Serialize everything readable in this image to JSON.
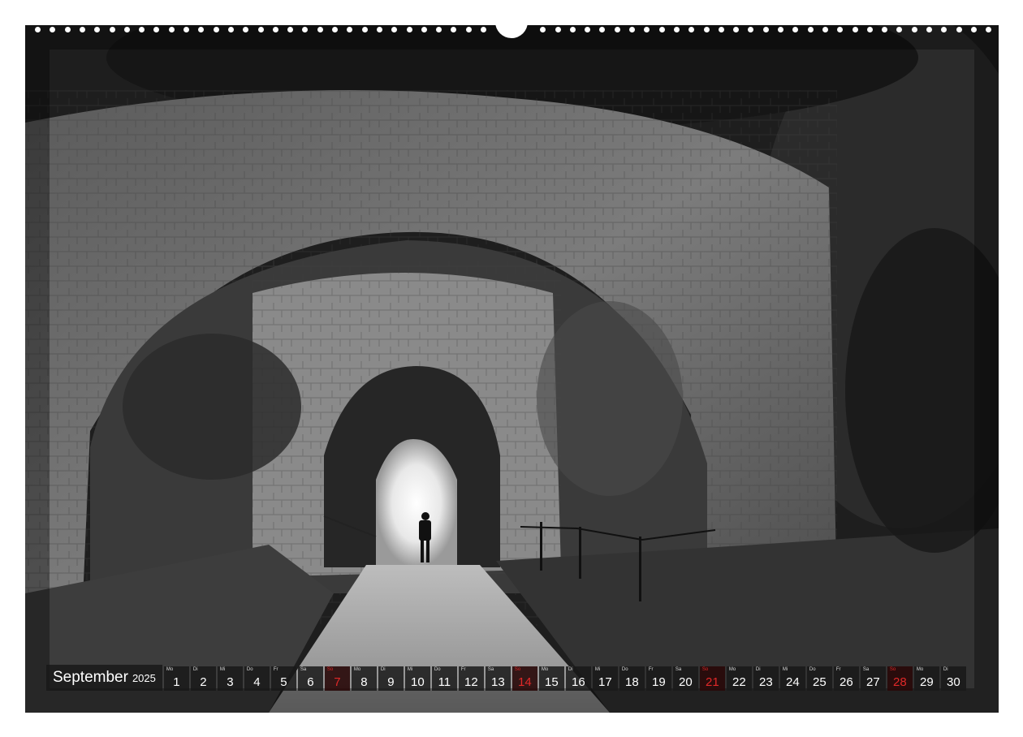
{
  "calendar": {
    "month": "September",
    "year": "2025",
    "days": [
      {
        "wd": "Mo",
        "num": "1"
      },
      {
        "wd": "Di",
        "num": "2"
      },
      {
        "wd": "Mi",
        "num": "3"
      },
      {
        "wd": "Do",
        "num": "4"
      },
      {
        "wd": "Fr",
        "num": "5"
      },
      {
        "wd": "Sa",
        "num": "6"
      },
      {
        "wd": "So",
        "num": "7",
        "sunday": true
      },
      {
        "wd": "Mo",
        "num": "8"
      },
      {
        "wd": "Di",
        "num": "9"
      },
      {
        "wd": "Mi",
        "num": "10"
      },
      {
        "wd": "Do",
        "num": "11"
      },
      {
        "wd": "Fr",
        "num": "12"
      },
      {
        "wd": "Sa",
        "num": "13"
      },
      {
        "wd": "So",
        "num": "14",
        "sunday": true
      },
      {
        "wd": "Mo",
        "num": "15"
      },
      {
        "wd": "Di",
        "num": "16"
      },
      {
        "wd": "Mi",
        "num": "17"
      },
      {
        "wd": "Do",
        "num": "18"
      },
      {
        "wd": "Fr",
        "num": "19"
      },
      {
        "wd": "Sa",
        "num": "20"
      },
      {
        "wd": "So",
        "num": "21",
        "sunday": true
      },
      {
        "wd": "Mo",
        "num": "22"
      },
      {
        "wd": "Di",
        "num": "23"
      },
      {
        "wd": "Mi",
        "num": "24"
      },
      {
        "wd": "Do",
        "num": "25"
      },
      {
        "wd": "Fr",
        "num": "26"
      },
      {
        "wd": "Sa",
        "num": "27"
      },
      {
        "wd": "So",
        "num": "28",
        "sunday": true
      },
      {
        "wd": "Mo",
        "num": "29"
      },
      {
        "wd": "Di",
        "num": "30"
      }
    ]
  },
  "colors": {
    "sunday": "#e02828",
    "day_cell": "#191919",
    "paper": "#ffffff"
  }
}
